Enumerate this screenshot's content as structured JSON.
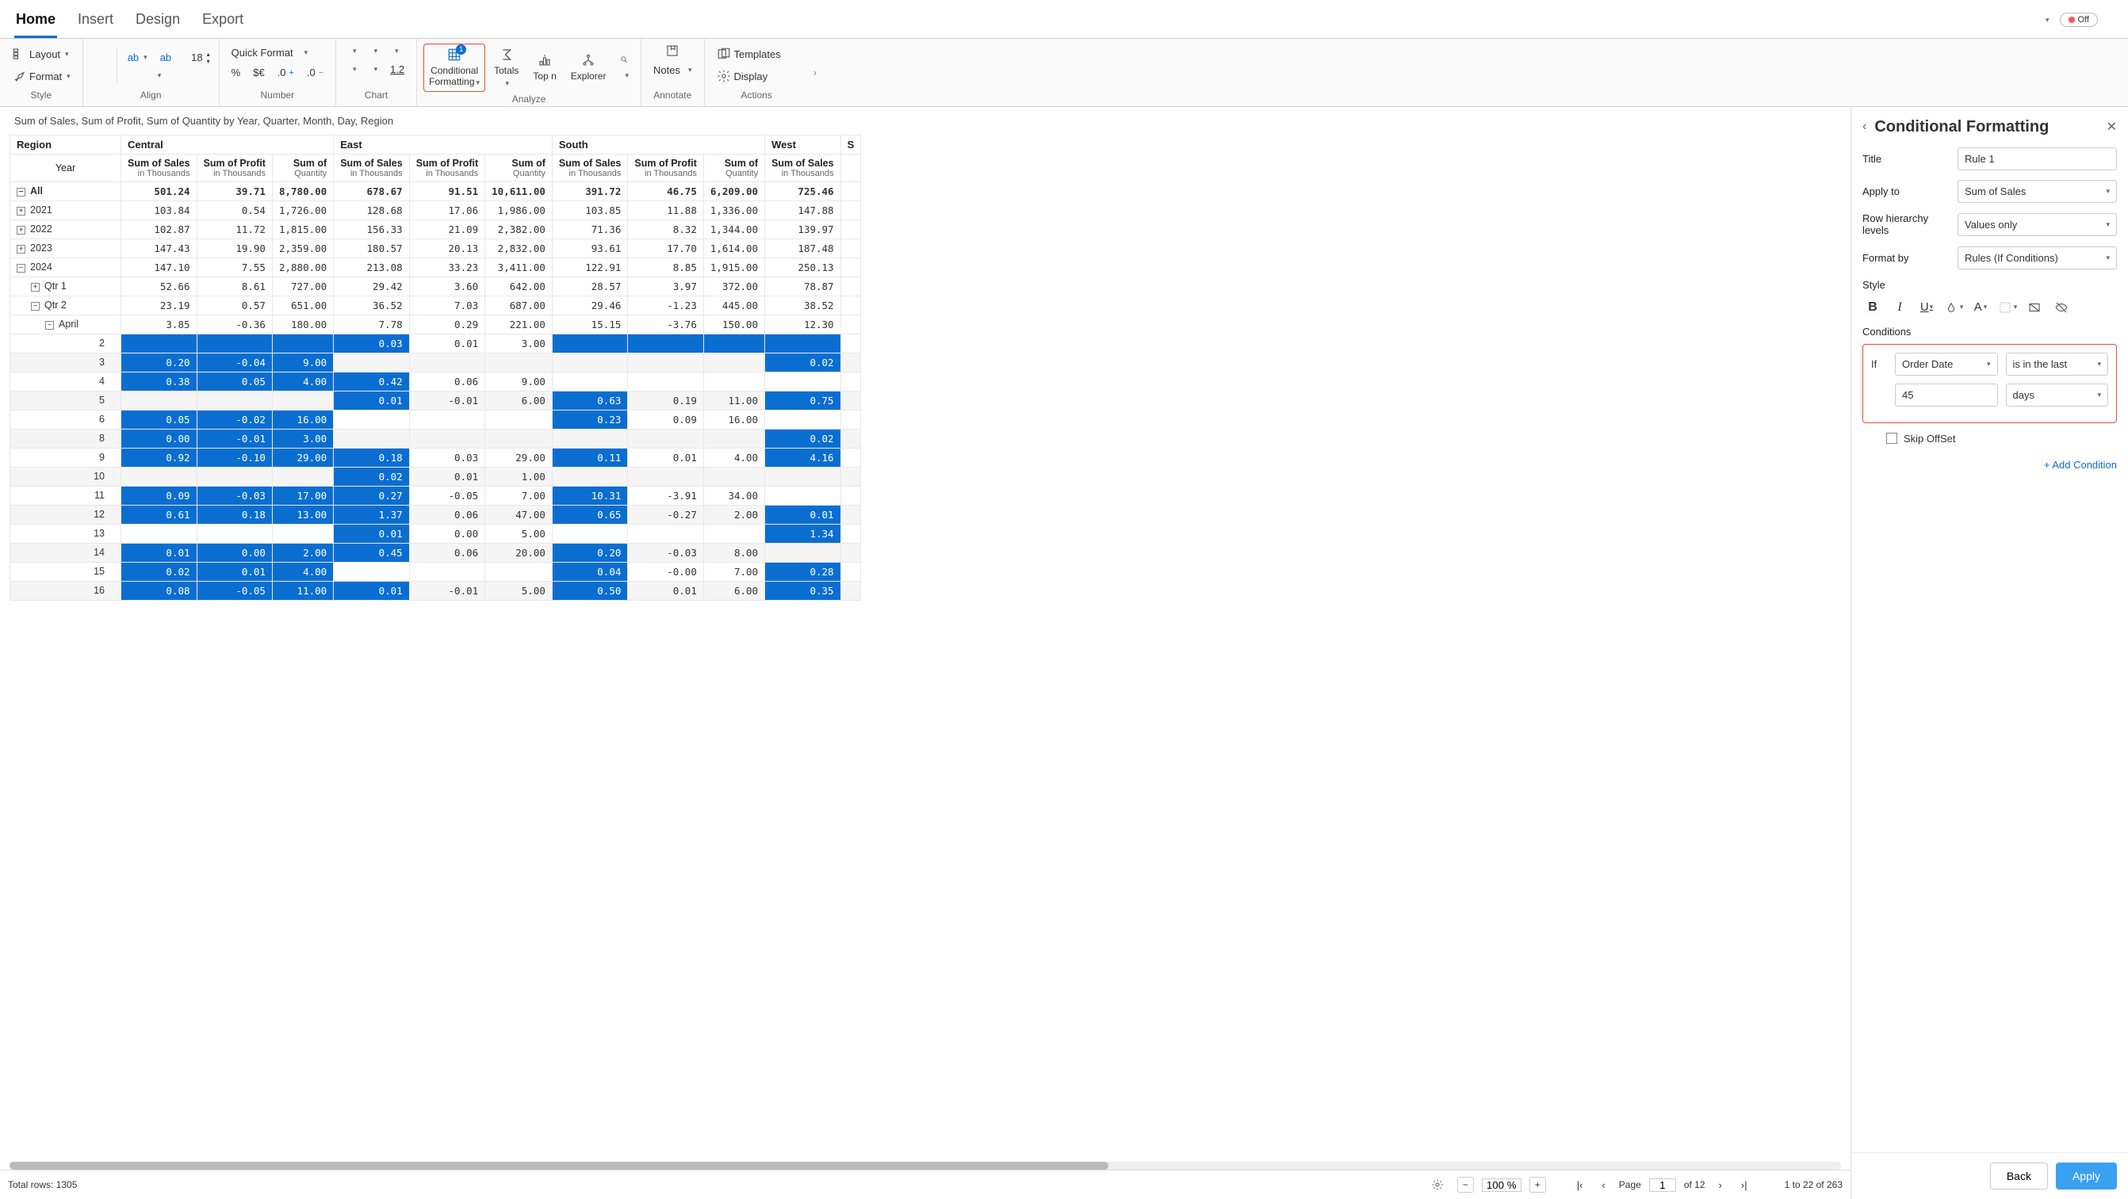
{
  "tabs": {
    "home": "Home",
    "insert": "Insert",
    "design": "Design",
    "export": "Export"
  },
  "ribbon": {
    "style": {
      "layout": "Layout",
      "format": "Format",
      "group_label": "Style"
    },
    "align": {
      "font_size": "18",
      "group_label": "Align"
    },
    "number": {
      "quick_format": "Quick Format",
      "pct": "%",
      "cur": "$€",
      "inc": ".0",
      "dec": ".0",
      "group_label": "Number"
    },
    "chart": {
      "num": "1.2",
      "group_label": "Chart"
    },
    "analyze": {
      "conditional": "Conditional",
      "formatting": "Formatting",
      "badge": "1",
      "totals": "Totals",
      "topn": "Top n",
      "explorer": "Explorer",
      "group_label": "Analyze"
    },
    "annotate": {
      "notes": "Notes",
      "group_label": "Annotate"
    },
    "actions": {
      "templates": "Templates",
      "display": "Display",
      "group_label": "Actions"
    },
    "off_toggle": "Off"
  },
  "description": "Sum of Sales, Sum of Profit, Sum of Quantity by Year, Quarter, Month, Day, Region",
  "grid": {
    "corner_region": "Region",
    "corner_year": "Year",
    "regions": [
      "Central",
      "East",
      "South",
      "West"
    ],
    "measures": [
      {
        "h1": "Sum of Sales",
        "h2": "in Thousands"
      },
      {
        "h1": "Sum of Profit",
        "h2": "in Thousands"
      },
      {
        "h1": "Sum of",
        "h2": "Quantity"
      }
    ],
    "row_all": {
      "label": "All",
      "exp": "−",
      "v": [
        "501.24",
        "39.71",
        "8,780.00",
        "678.67",
        "91.51",
        "10,611.00",
        "391.72",
        "46.75",
        "6,209.00",
        "725.46"
      ]
    },
    "rows_years": [
      {
        "label": "2021",
        "exp": "+",
        "v": [
          "103.84",
          "0.54",
          "1,726.00",
          "128.68",
          "17.06",
          "1,986.00",
          "103.85",
          "11.88",
          "1,336.00",
          "147.88"
        ]
      },
      {
        "label": "2022",
        "exp": "+",
        "v": [
          "102.87",
          "11.72",
          "1,815.00",
          "156.33",
          "21.09",
          "2,382.00",
          "71.36",
          "8.32",
          "1,344.00",
          "139.97"
        ]
      },
      {
        "label": "2023",
        "exp": "+",
        "v": [
          "147.43",
          "19.90",
          "2,359.00",
          "180.57",
          "20.13",
          "2,832.00",
          "93.61",
          "17.70",
          "1,614.00",
          "187.48"
        ]
      },
      {
        "label": "2024",
        "exp": "−",
        "v": [
          "147.10",
          "7.55",
          "2,880.00",
          "213.08",
          "33.23",
          "3,411.00",
          "122.91",
          "8.85",
          "1,915.00",
          "250.13"
        ]
      }
    ],
    "rows_qtrs": [
      {
        "label": "Qtr 1",
        "exp": "+",
        "indent": 1,
        "v": [
          "52.66",
          "8.61",
          "727.00",
          "29.42",
          "3.60",
          "642.00",
          "28.57",
          "3.97",
          "372.00",
          "78.87"
        ]
      },
      {
        "label": "Qtr 2",
        "exp": "−",
        "indent": 1,
        "v": [
          "23.19",
          "0.57",
          "651.00",
          "36.52",
          "7.03",
          "687.00",
          "29.46",
          "-1.23",
          "445.00",
          "38.52"
        ]
      }
    ],
    "row_april": {
      "label": "April",
      "exp": "−",
      "indent": 2,
      "v": [
        "3.85",
        "-0.36",
        "180.00",
        "7.78",
        "0.29",
        "221.00",
        "15.15",
        "-3.76",
        "150.00",
        "12.30"
      ]
    },
    "rows_days": [
      {
        "label": "2",
        "v": [
          "",
          "",
          "",
          "0.03",
          "0.01",
          "3.00",
          "",
          "",
          "",
          ""
        ],
        "hl": [
          0,
          1,
          2,
          3,
          6,
          7,
          8,
          9
        ]
      },
      {
        "label": "3",
        "v": [
          "0.20",
          "-0.04",
          "9.00",
          "",
          "",
          "",
          "",
          "",
          "",
          "0.02"
        ],
        "hl": [
          0,
          1,
          2,
          9
        ]
      },
      {
        "label": "4",
        "v": [
          "0.38",
          "0.05",
          "4.00",
          "0.42",
          "0.06",
          "9.00",
          "",
          "",
          "",
          ""
        ],
        "hl": [
          0,
          1,
          2,
          3
        ]
      },
      {
        "label": "5",
        "v": [
          "",
          "",
          "",
          "0.01",
          "-0.01",
          "6.00",
          "0.63",
          "0.19",
          "11.00",
          "0.75"
        ],
        "hl": [
          3,
          6,
          9
        ]
      },
      {
        "label": "6",
        "v": [
          "0.05",
          "-0.02",
          "16.00",
          "",
          "",
          "",
          "0.23",
          "0.09",
          "16.00",
          ""
        ],
        "hl": [
          0,
          1,
          2,
          6
        ]
      },
      {
        "label": "8",
        "v": [
          "0.00",
          "-0.01",
          "3.00",
          "",
          "",
          "",
          "",
          "",
          "",
          "0.02"
        ],
        "hl": [
          0,
          1,
          2,
          9
        ]
      },
      {
        "label": "9",
        "v": [
          "0.92",
          "-0.10",
          "29.00",
          "0.18",
          "0.03",
          "29.00",
          "0.11",
          "0.01",
          "4.00",
          "4.16"
        ],
        "hl": [
          0,
          1,
          2,
          3,
          6,
          9
        ]
      },
      {
        "label": "10",
        "v": [
          "",
          "",
          "",
          "0.02",
          "0.01",
          "1.00",
          "",
          "",
          "",
          ""
        ],
        "hl": [
          3
        ]
      },
      {
        "label": "11",
        "v": [
          "0.09",
          "-0.03",
          "17.00",
          "0.27",
          "-0.05",
          "7.00",
          "10.31",
          "-3.91",
          "34.00",
          ""
        ],
        "hl": [
          0,
          1,
          2,
          3,
          6
        ]
      },
      {
        "label": "12",
        "v": [
          "0.61",
          "0.18",
          "13.00",
          "1.37",
          "0.06",
          "47.00",
          "0.65",
          "-0.27",
          "2.00",
          "0.01"
        ],
        "hl": [
          0,
          1,
          2,
          3,
          6,
          9
        ]
      },
      {
        "label": "13",
        "v": [
          "",
          "",
          "",
          "0.01",
          "0.00",
          "5.00",
          "",
          "",
          "",
          "1.34"
        ],
        "hl": [
          3,
          9
        ]
      },
      {
        "label": "14",
        "v": [
          "0.01",
          "0.00",
          "2.00",
          "0.45",
          "0.06",
          "20.00",
          "0.20",
          "-0.03",
          "8.00",
          ""
        ],
        "hl": [
          0,
          1,
          2,
          3,
          6
        ]
      },
      {
        "label": "15",
        "v": [
          "0.02",
          "0.01",
          "4.00",
          "",
          "",
          "",
          "0.04",
          "-0.00",
          "7.00",
          "0.28"
        ],
        "hl": [
          0,
          1,
          2,
          6,
          9
        ]
      },
      {
        "label": "16",
        "v": [
          "0.08",
          "-0.05",
          "11.00",
          "0.01",
          "-0.01",
          "5.00",
          "0.50",
          "0.01",
          "6.00",
          "0.35"
        ],
        "hl": [
          0,
          1,
          2,
          3,
          6,
          9
        ]
      }
    ],
    "extra_col_header": "S"
  },
  "status": {
    "total_rows": "Total rows: 1305",
    "zoom": "100 %",
    "page_label": "Page",
    "page_current": "1",
    "page_total": "of 12",
    "items_range": "1  to  22  of  263"
  },
  "panel": {
    "title": "Conditional Formatting",
    "title_label": "Title",
    "title_value": "Rule 1",
    "applyto_label": "Apply to",
    "applyto_value": "Sum of Sales",
    "rowhier_label": "Row hierarchy levels",
    "rowhier_value": "Values only",
    "formatby_label": "Format by",
    "formatby_value": "Rules (If Conditions)",
    "style_label": "Style",
    "conditions_label": "Conditions",
    "if_label": "If",
    "field": "Order Date",
    "operator": "is in the last",
    "value": "45",
    "unit": "days",
    "skip_offset": "Skip OffSet",
    "add_condition": "+ Add Condition",
    "back_btn": "Back",
    "apply_btn": "Apply"
  }
}
